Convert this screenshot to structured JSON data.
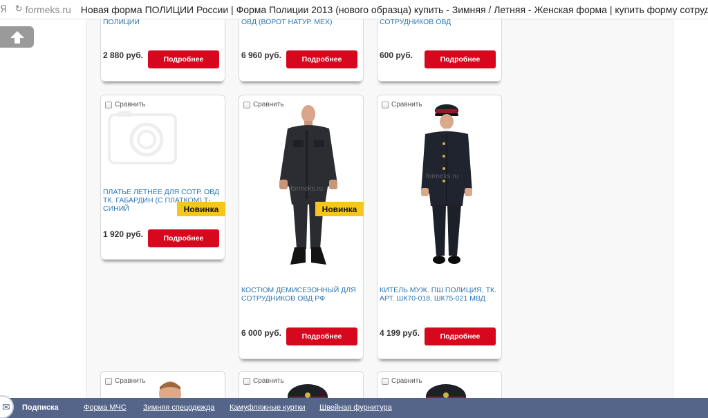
{
  "browser": {
    "logo": "Я",
    "reload_glyph": "↻",
    "domain": "formeks.ru",
    "title": "Новая форма ПОЛИЦИИ России | Форма Полиции 2013 (нового образца) купить - Зимняя / Летняя - Женская форма | купить форму сотрудн"
  },
  "compare_label": "Сравнить",
  "more_label": "Подробнее",
  "new_badge": "Новинка",
  "watermark": "formeks.ru",
  "products_top": [
    {
      "name": "ПОЛИЦИИ",
      "price": "2 880 руб."
    },
    {
      "name": "ОВД (ВОРОТ НАТУР. МЕХ)",
      "price": "6 960 руб."
    },
    {
      "name": "ТЕКСТИЛЬНЫЙ ДЛЯ СОТРУДНИКОВ ОВД",
      "price": "600 руб."
    }
  ],
  "products_middle": [
    {
      "name": "ПЛАТЬЕ ЛЕТНЕЕ ДЛЯ СОТР. ОВД ТК. ГАБАРДИН (С ПЛАТКОМ) Т-СИНИЙ",
      "price": "1 920 руб."
    },
    {
      "name": "КОСТЮМ ДЕМИСЕЗОННЫЙ ДЛЯ СОТРУДНИКОВ ОВД РФ",
      "price": "6 000 руб."
    },
    {
      "name": "КИТЕЛЬ МУЖ. ПШ ПОЛИЦИЯ, ТК. АРТ. ШК70-018, ШК75-021 МВД",
      "price": "4 199 руб."
    }
  ],
  "icons": {
    "scroll_top": "up-arrow-icon",
    "placeholder": "camera-placeholder-icon"
  },
  "footer": {
    "subscribe": "Подписка",
    "links": [
      "Форма МЧС",
      "Зимняя спецодежда",
      "Камуфляжные куртки",
      "Швейная фурнитура"
    ]
  },
  "colors": {
    "accent_red": "#d7081d",
    "badge_yellow": "#f7c51f",
    "link_blue": "#2a76b5",
    "footer_bg": "#55658a"
  }
}
